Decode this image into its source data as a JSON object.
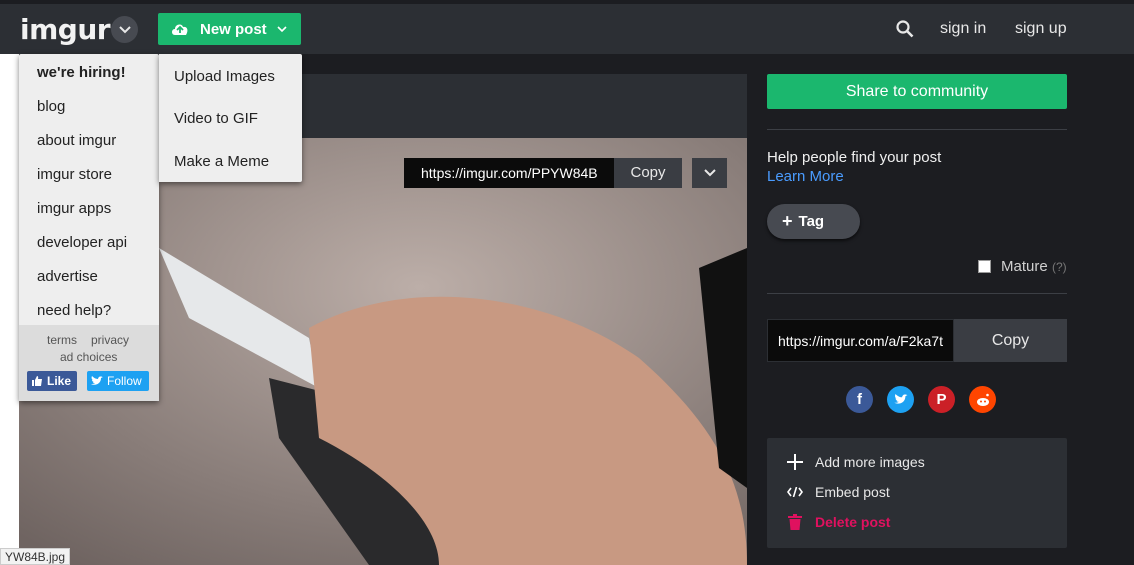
{
  "header": {
    "logo": "imgur",
    "new_post_label": "New post",
    "sign_in": "sign in",
    "sign_up": "sign up"
  },
  "menu_left": {
    "items": [
      "we're hiring!",
      "blog",
      "about imgur",
      "imgur store",
      "imgur apps",
      "developer api",
      "advertise",
      "need help?"
    ],
    "footer_links": [
      "terms",
      "privacy",
      "ad choices"
    ],
    "like_label": "Like",
    "follow_label": "Follow"
  },
  "menu_right": {
    "items": [
      "Upload Images",
      "Video to GIF",
      "Make a Meme"
    ]
  },
  "post": {
    "image_url": "https://imgur.com/PPYW84B",
    "copy_label": "Copy",
    "caption": "YW84B.jpg"
  },
  "sidebar": {
    "share_label": "Share to community",
    "help_text": "Help people find your post",
    "learn_more": "Learn More",
    "tag_label": "Tag",
    "mature_label": "Mature",
    "mature_help": "(?)",
    "album_url": "https://imgur.com/a/F2ka7t",
    "album_copy_label": "Copy",
    "actions": {
      "add_more": "Add more images",
      "embed": "Embed post",
      "delete": "Delete post"
    }
  },
  "colors": {
    "accent_green": "#1bb76e",
    "header_bg": "#2c2f34",
    "page_bg": "#1c1d21",
    "link_blue": "#4a9cff",
    "delete_pink": "#e0115f"
  },
  "icons": [
    "chevron-down-icon",
    "cloud-upload-icon",
    "search-icon",
    "plus-icon",
    "code-icon",
    "trash-icon",
    "facebook-icon",
    "twitter-icon",
    "pinterest-icon",
    "reddit-icon"
  ]
}
